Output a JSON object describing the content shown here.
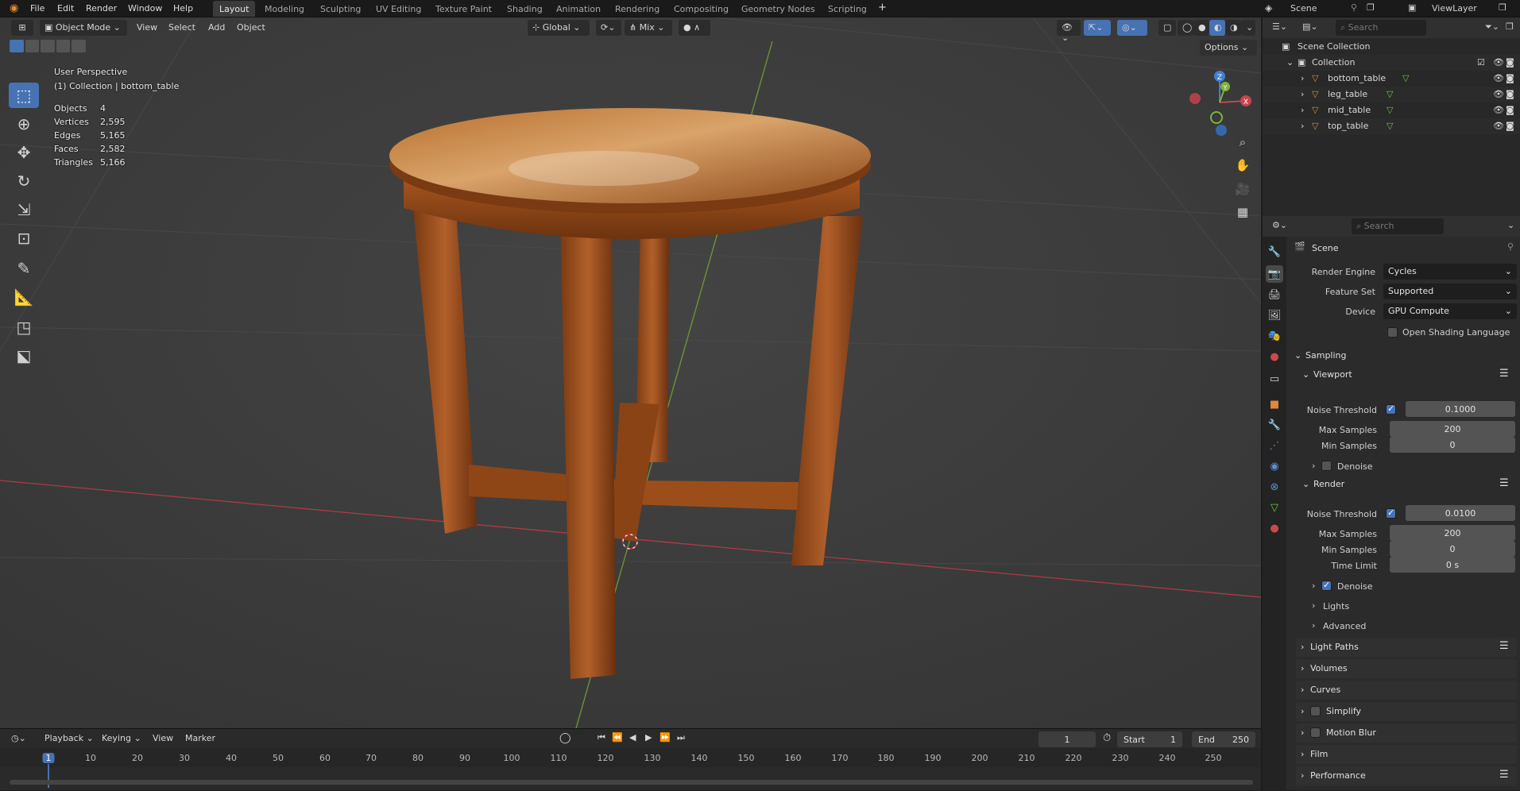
{
  "topbar": {
    "menus": [
      "File",
      "Edit",
      "Render",
      "Window",
      "Help"
    ],
    "workspaces": [
      "Layout",
      "Modeling",
      "Sculpting",
      "UV Editing",
      "Texture Paint",
      "Shading",
      "Animation",
      "Rendering",
      "Compositing",
      "Geometry Nodes",
      "Scripting"
    ],
    "active_workspace": "Layout",
    "scene": "Scene",
    "view_layer": "ViewLayer"
  },
  "viewport_header": {
    "mode": "Object Mode",
    "menus": [
      "View",
      "Select",
      "Add",
      "Object"
    ],
    "orientation": "Global",
    "pivot": "Mix",
    "options": "Options"
  },
  "overlay": {
    "view_name": "User Perspective",
    "collection_line": "(1) Collection | bottom_table",
    "stats": [
      {
        "label": "Objects",
        "value": "4"
      },
      {
        "label": "Vertices",
        "value": "2,595"
      },
      {
        "label": "Edges",
        "value": "5,165"
      },
      {
        "label": "Faces",
        "value": "2,582"
      },
      {
        "label": "Triangles",
        "value": "5,166"
      }
    ]
  },
  "gizmo": {
    "x": "X",
    "y": "Y",
    "z": "Z"
  },
  "timeline": {
    "menus": [
      "Playback",
      "Keying",
      "View",
      "Marker"
    ],
    "current_frame": "1",
    "start_label": "Start",
    "start": "1",
    "end_label": "End",
    "end": "250",
    "ticks": [
      "1",
      "10",
      "20",
      "30",
      "40",
      "50",
      "60",
      "70",
      "80",
      "90",
      "100",
      "110",
      "120",
      "130",
      "140",
      "150",
      "160",
      "170",
      "180",
      "190",
      "200",
      "210",
      "220",
      "230",
      "240",
      "250"
    ]
  },
  "outliner": {
    "search_placeholder": "Search",
    "scene_collection": "Scene Collection",
    "collection": "Collection",
    "objects": [
      "bottom_table",
      "leg_table",
      "mid_table",
      "top_table"
    ]
  },
  "properties": {
    "search_placeholder": "Search",
    "context": "Scene",
    "render_engine_label": "Render Engine",
    "render_engine": "Cycles",
    "feature_set_label": "Feature Set",
    "feature_set": "Supported",
    "device_label": "Device",
    "device": "GPU Compute",
    "osl_label": "Open Shading Language",
    "sampling": "Sampling",
    "viewport": "Viewport",
    "noise_threshold_label": "Noise Threshold",
    "vp_noise_threshold": "0.1000",
    "max_samples_label": "Max Samples",
    "vp_max_samples": "200",
    "min_samples_label": "Min Samples",
    "vp_min_samples": "0",
    "denoise_label": "Denoise",
    "render": "Render",
    "r_noise_threshold": "0.0100",
    "r_max_samples": "200",
    "r_min_samples": "0",
    "time_limit_label": "Time Limit",
    "time_limit": "0 s",
    "lights": "Lights",
    "advanced": "Advanced",
    "panels": [
      "Light Paths",
      "Volumes",
      "Curves",
      "Simplify",
      "Motion Blur",
      "Film",
      "Performance"
    ]
  },
  "colors": {
    "accent": "#4772b3",
    "x_axis": "#c8444d",
    "y_axis": "#7fb33a",
    "z_axis": "#3f7fd1",
    "wood": "#9a4a1c"
  }
}
